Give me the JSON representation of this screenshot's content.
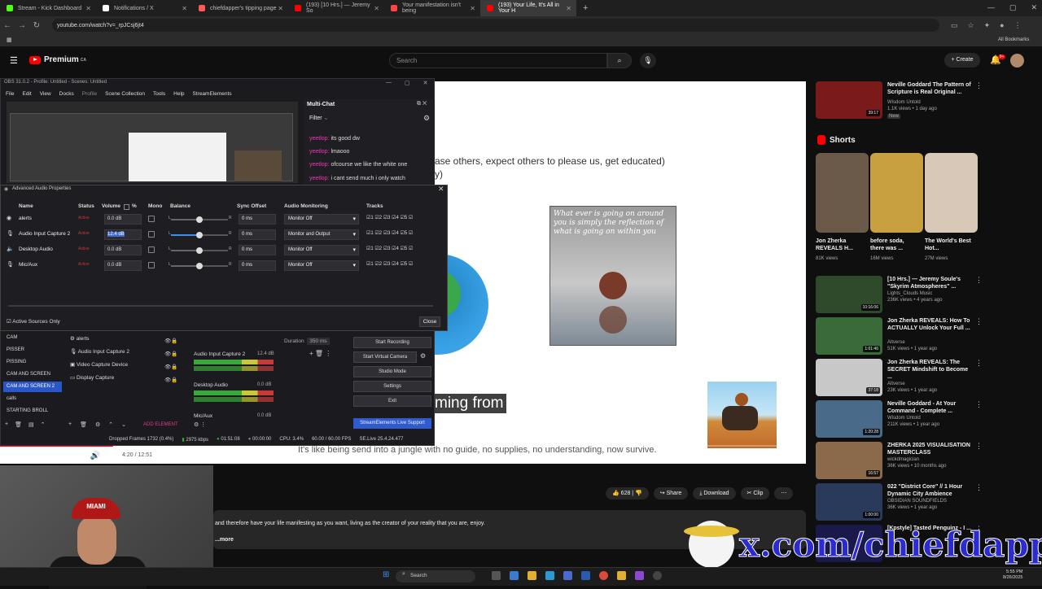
{
  "browser": {
    "tabs": [
      {
        "title": "Stream - Kick Dashboard",
        "color": "#53fc18",
        "active": false
      },
      {
        "title": "Notifications / X",
        "color": "#ffffff",
        "active": false
      },
      {
        "title": "chiefdapper's tipping page",
        "color": "#ff5a5a",
        "active": false
      },
      {
        "title": "(193) [10 Hrs.] — Jeremy So",
        "color": "#ff0000",
        "active": false
      },
      {
        "title": "Your manifestation isn't being",
        "color": "#ff4444",
        "active": false
      },
      {
        "title": "(193) Your Life, It's All in Your H",
        "color": "#ff0000",
        "active": true
      }
    ],
    "new_tab": "+",
    "url": "youtube.com/watch?v=_rpJCsj6jt4",
    "all_bookmarks": "All Bookmarks"
  },
  "youtube": {
    "brand": "Premium",
    "brand_sup": "CA",
    "search_placeholder": "Search",
    "create_label": "Create",
    "notif_count": "9+"
  },
  "video": {
    "caption_line1": "ase others, expect others to please us, get educated)",
    "caption_line1b": "y)",
    "quote": "What ever is going on around you is simply the reflection of what is going on within you",
    "caption_big": "ming from",
    "caption_bottom": "It's like being send into a jungle with no guide, no supplies, no understanding, now survive.",
    "time": "4:20 / 12:51",
    "progress": 0.14
  },
  "actions": {
    "likes": "628",
    "share": "Share",
    "download": "Download",
    "clip": "Clip"
  },
  "description": {
    "text": "and therefore have your life manifesting as you want, living as the creator of your reality that you are, enjoy.",
    "more": "...more"
  },
  "sidebar": {
    "top_video": {
      "title": "Neville Goddard  The Pattern of Scripture is Real  Original ...",
      "channel": "Wisdom Untold",
      "meta": "1.1K views • 1 day ago",
      "badge": "New",
      "duration": "39:17"
    },
    "shorts_title": "Shorts",
    "shorts": [
      {
        "title": "Jon Zherka REVEALS H...",
        "views": "81K views",
        "color": "#6b5a4a"
      },
      {
        "title": "before soda, there was ...",
        "views": "16M views",
        "color": "#c8a040"
      },
      {
        "title": "The World's Best Hot...",
        "views": "27M views",
        "color": "#d8c8b8"
      }
    ],
    "videos": [
      {
        "title": "[10 Hrs.] — Jeremy Soule's \"Skyrim Atmospheres\" ...",
        "channel": "Lights_Clouds Music",
        "meta": "236K views • 4 years ago",
        "duration": "10:16:06",
        "color": "#2f4a2a"
      },
      {
        "title": "Jon Zherka REVEALS: How To ACTUALLY Unlock Your Full ...",
        "channel": "Altverse",
        "meta": "51K views • 1 year ago",
        "duration": "1:01:46",
        "color": "#3a6a3a"
      },
      {
        "title": "Jon Zherka REVEALS: The SECRET Mindshift to Become ...",
        "channel": "Altverse",
        "meta": "23K views • 1 year ago",
        "duration": "37:18",
        "color": "#c8c8c8"
      },
      {
        "title": "Neville Goddard - At Your Command - Complete ...",
        "channel": "Wisdom Untold",
        "meta": "211K views • 1 year ago",
        "duration": "1:20:28",
        "color": "#4a6a8a"
      },
      {
        "title": "ZHERKA 2025 VISUALISATION MASTERCLASS",
        "channel": "wickdmagician",
        "meta": "36K views • 10 months ago",
        "duration": "16:57",
        "color": "#8a6a4a"
      },
      {
        "title": "022 \"District Core\" // 1 Hour Dynamic City Ambience",
        "channel": "OBSIDIAN SOUNDFIELDS",
        "meta": "36K views • 1 year ago",
        "duration": "1:00:00",
        "color": "#2a3a5a"
      },
      {
        "title": "[Kpstyle] Tasted Penguinz - I ...",
        "channel": "",
        "meta": "",
        "duration": "",
        "color": "#1a1a4a"
      }
    ]
  },
  "obs": {
    "title": "OBS 31.0.2 - Profile: Untitled - Scenes: Untitled",
    "menu": [
      "File",
      "Edit",
      "View",
      "Docks",
      "Profile",
      "Scene Collection",
      "Tools",
      "Help",
      "StreamElements"
    ],
    "multichat": {
      "title": "Multi-Chat",
      "filter": "Filter",
      "lines": [
        {
          "user": "yeetlop:",
          "msg": "its good dw"
        },
        {
          "user": "yeetlop:",
          "msg": "lmaooo"
        },
        {
          "user": "yeetlop:",
          "msg": "ofcourse we like the white one"
        },
        {
          "user": "yeetlop:",
          "msg": "i cant send much i only watch"
        }
      ]
    },
    "advanced_audio": {
      "title": "Advanced Audio Properties",
      "headers": {
        "name": "Name",
        "status": "Status",
        "volume": "Volume",
        "pct": "%",
        "mono": "Mono",
        "balance": "Balance",
        "sync": "Sync Offset",
        "monitoring": "Audio Monitoring",
        "tracks": "Tracks"
      },
      "rows": [
        {
          "name": "alerts",
          "status": "Active",
          "volume": "0.0 dB",
          "sync": "0 ms",
          "monitoring": "Monitor Off",
          "balance": 0.5,
          "selected": false
        },
        {
          "name": "Audio Input Capture 2",
          "status": "Active",
          "volume": "12.4 dB",
          "sync": "0 ms",
          "monitoring": "Monitor and Output",
          "balance": 0.5,
          "selected": true
        },
        {
          "name": "Desktop Audio",
          "status": "Active",
          "volume": "0.0 dB",
          "sync": "0 ms",
          "monitoring": "Monitor Off",
          "balance": 0.5,
          "selected": false
        },
        {
          "name": "Mic/Aux",
          "status": "Active",
          "volume": "0.0 dB",
          "sync": "0 ms",
          "monitoring": "Monitor Off",
          "balance": 0.5,
          "selected": false
        }
      ],
      "tracks": "☑1 ☑2 ☑3 ☑4 ☑5 ☑",
      "active_only": "Active Sources Only",
      "close": "Close"
    },
    "scenes": [
      "CAM",
      "PISSER",
      "PISSING",
      "CAM AND SCREEN",
      "CAM AND SCREEN 2",
      "calls",
      "STARTING BROLL"
    ],
    "selected_scene": "CAM AND SCREEN 2",
    "sources": [
      "alerts",
      "Audio Input Capture 2",
      "Video Capture Device",
      "Display Capture"
    ],
    "mixer": [
      {
        "name": "Audio Input Capture 2",
        "db": "12.4 dB"
      },
      {
        "name": "Desktop Audio",
        "db": "0.0 dB"
      },
      {
        "name": "Mic/Aux",
        "db": "0.0 dB"
      }
    ],
    "duration_label": "Duration",
    "duration_value": "350 ms",
    "controls": [
      "Start Recording",
      "Start Virtual Camera",
      "Studio Mode",
      "Settings",
      "Exit"
    ],
    "se_support": "StreamElements Live Support",
    "add_element": "ADD ELEMENT",
    "status": {
      "dropped": "Dropped Frames 1732 (0.4%)",
      "kbps": "2975 kbps",
      "live_time": "01:51:08",
      "rec_time": "00:00:00",
      "cpu": "CPU: 3.4%",
      "fps": "60.00 / 60.00 FPS",
      "se": "SE.Live 25.4.24.477"
    }
  },
  "webcam": {
    "cap_text": "MIAMI"
  },
  "watermark": "x.com/chiefdapper",
  "taskbar": {
    "search": "Search",
    "clock_time": "5:55 PM",
    "clock_date": "8/26/2025"
  }
}
